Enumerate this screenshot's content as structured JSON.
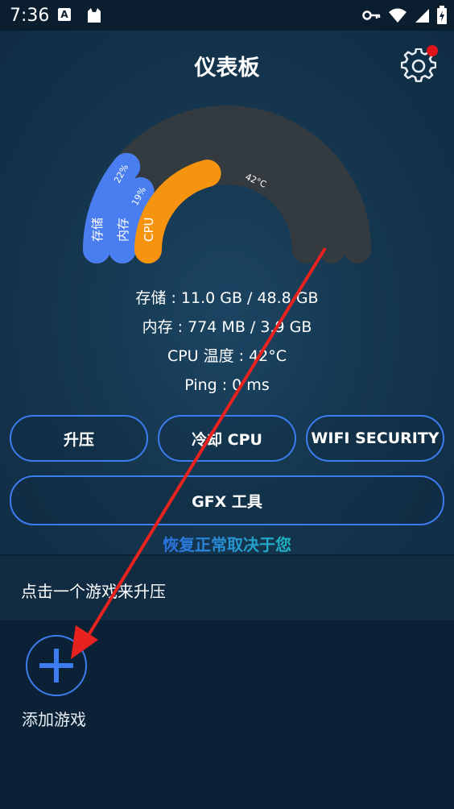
{
  "status_bar": {
    "time": "7:36",
    "icons": [
      "a-icon",
      "cat-icon",
      "key-icon",
      "wifi-icon",
      "signal-icon",
      "battery-icon"
    ]
  },
  "header": {
    "title": "仪表板"
  },
  "gauge": {
    "storage": {
      "label": "存储",
      "percent_label": "22%",
      "percent": 22,
      "color": "#4a7ef0"
    },
    "memory": {
      "label": "内存",
      "percent_label": "19%",
      "percent": 19,
      "color": "#4a7ef0"
    },
    "cpu": {
      "label": "CPU",
      "temp_label": "42°C",
      "percent": 42,
      "color": "#f7940f"
    },
    "track_color": "#343b40"
  },
  "stats": {
    "storage": "存储 : 11.0 GB / 48.8 GB",
    "memory": "内存 : 774 MB / 3.9 GB",
    "cpu_temp": "CPU 温度 : 42°C",
    "ping": "Ping : 0 ms"
  },
  "buttons": {
    "boost": "升压",
    "cool_cpu": "冷却 CPU",
    "wifi_security": "WIFI SECURITY",
    "gfx_tool": "GFX 工具"
  },
  "restore_text": "恢复正常取决于您",
  "hint": "点击一个游戏来升压",
  "add_game": {
    "label": "添加游戏"
  },
  "colors": {
    "accent": "#3d7cf0",
    "background": "#0b2236",
    "notification": "#e0141a",
    "arrow": "#e8231f"
  }
}
